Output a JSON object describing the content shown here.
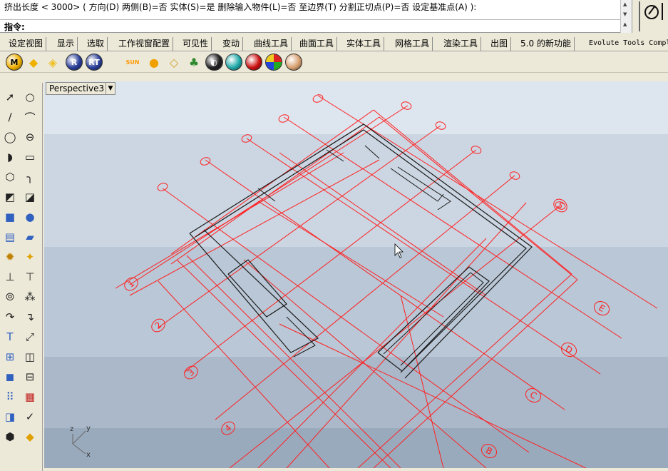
{
  "command": {
    "history_line": "挤出长度 < 3000> ( 方向(D) 两侧(B)=否 实体(S)=是 删除输入物件(L)=否 至边界(T) 分割正切点(P)=否 设定基准点(A) ):",
    "prompt_label": "指令:",
    "input_value": "",
    "input_placeholder": ""
  },
  "tabs": [
    {
      "label": "设定视图"
    },
    {
      "label": "显示"
    },
    {
      "label": "选取"
    },
    {
      "label": "工作视窗配置"
    },
    {
      "label": "可见性"
    },
    {
      "label": "变动"
    },
    {
      "label": "曲线工具"
    },
    {
      "label": "曲面工具"
    },
    {
      "label": "实体工具"
    },
    {
      "label": "网格工具"
    },
    {
      "label": "渲染工具"
    },
    {
      "label": "出图"
    },
    {
      "label": "5.0 的新功能"
    },
    {
      "label": "Evolute Tools Compl"
    }
  ],
  "toolbar_icons": [
    {
      "name": "m-icon",
      "glyph": "M",
      "color": "#f0b000"
    },
    {
      "name": "material-icon",
      "glyph": "◆",
      "color": "#f0b000"
    },
    {
      "name": "tag-icon",
      "glyph": "◈",
      "color": "#f0c020"
    },
    {
      "name": "r-icon",
      "glyph": "R",
      "color": "#2a3f9a"
    },
    {
      "name": "rt-icon",
      "glyph": "RT",
      "color": "#2a3f9a"
    },
    {
      "name": "sun-icon",
      "glyph": "SUN",
      "color": "#ff9900"
    },
    {
      "name": "light-icon",
      "glyph": "●",
      "color": "#f0a000"
    },
    {
      "name": "plane-icon",
      "glyph": "◇",
      "color": "#d0a030"
    },
    {
      "name": "tree-icon",
      "glyph": "♣",
      "color": "#2f8a2f"
    },
    {
      "name": "help-icon",
      "glyph": "?",
      "color": "#2a3f9a"
    },
    {
      "name": "env-icon",
      "glyph": "◐",
      "color": "#222222"
    },
    {
      "name": "teal-sphere-icon",
      "glyph": "",
      "color": "#20a8a8"
    },
    {
      "name": "red-sphere-icon",
      "glyph": "",
      "color": "#cc1111"
    },
    {
      "name": "multi-color-icon",
      "glyph": "",
      "color": "#dd3333"
    },
    {
      "name": "skin-sphere-icon",
      "glyph": "",
      "color": "#d8a070"
    }
  ],
  "viewport": {
    "title": "Perspective3",
    "axis_labels": {
      "z": "z",
      "y": "y",
      "x": "x"
    },
    "grid_labels_x": [
      "E",
      "D",
      "C",
      "B"
    ],
    "grid_labels_y": [
      "1",
      "2",
      "3",
      "4",
      "5"
    ]
  },
  "colors": {
    "grid_line": "#ff2020",
    "wall_line": "#1a1a1a",
    "viewport_bg": "#cbd6e2"
  }
}
